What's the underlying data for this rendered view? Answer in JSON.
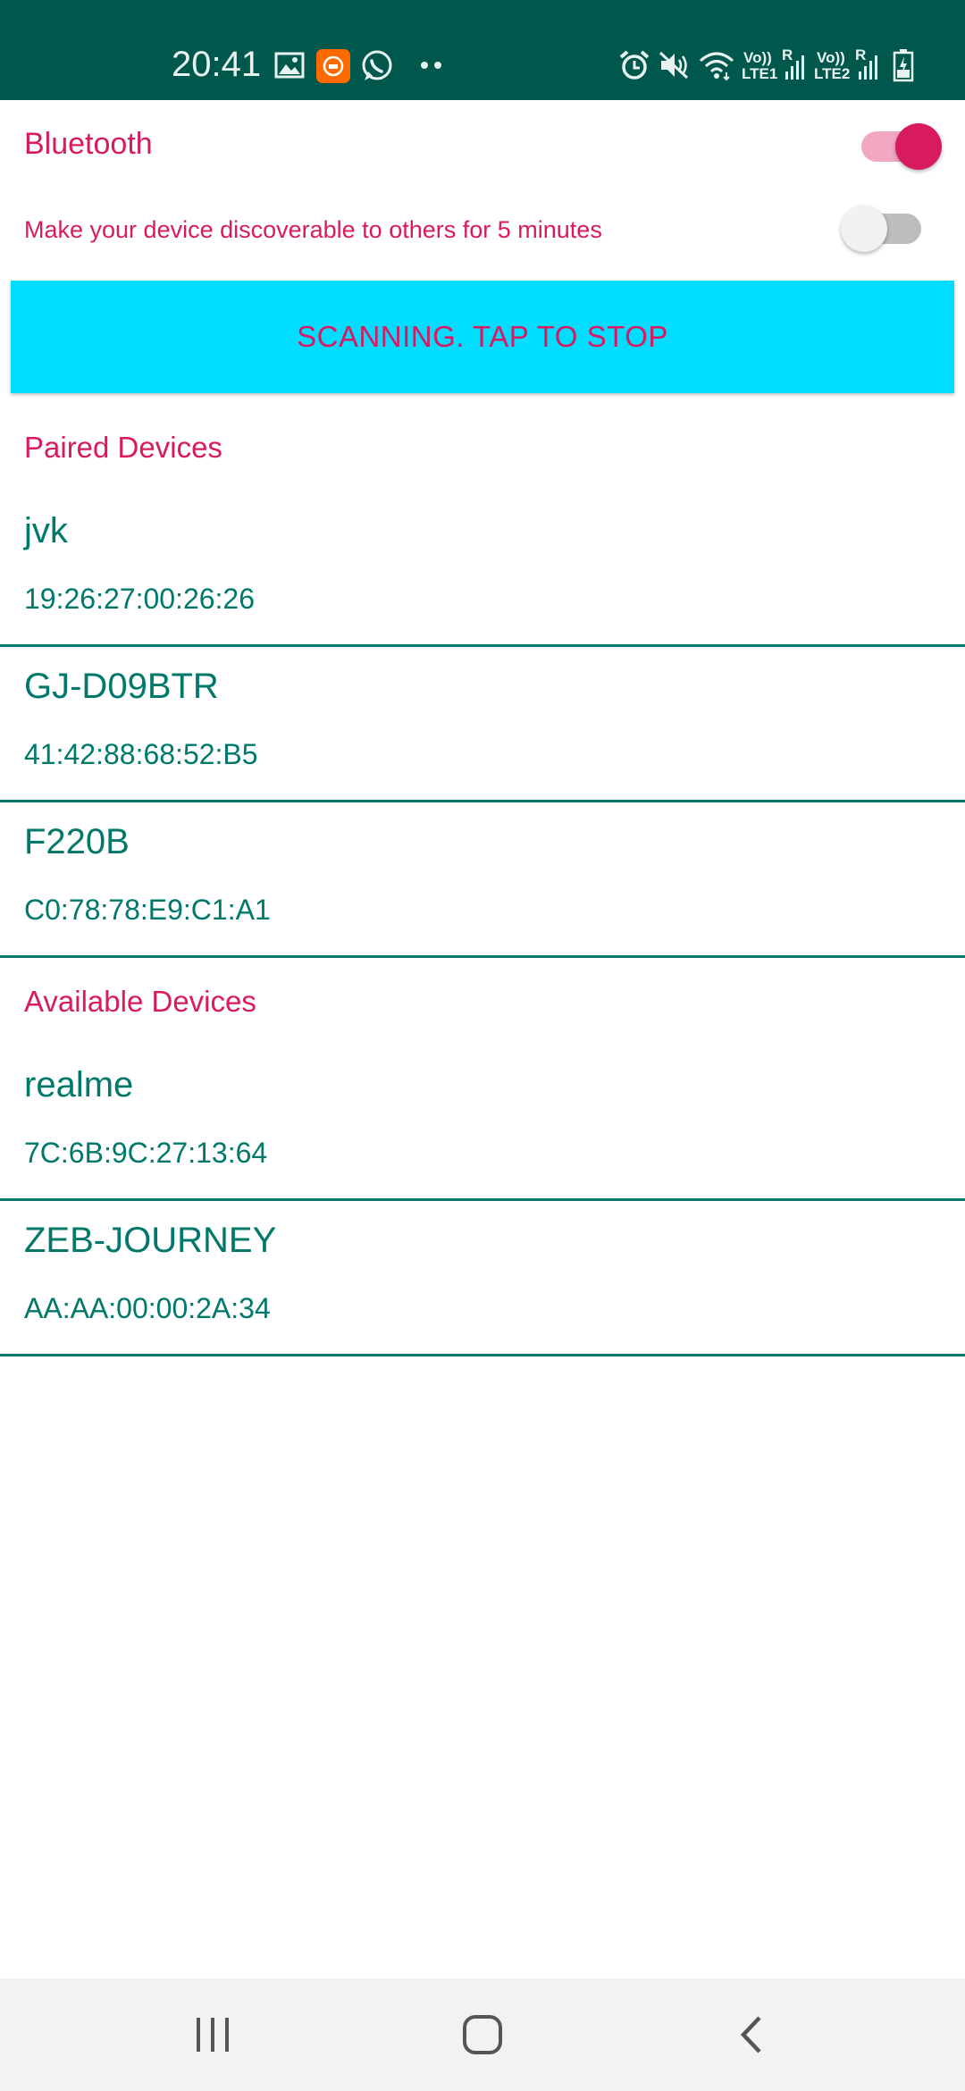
{
  "status_bar": {
    "time": "20:41",
    "sim1_label": "LTE1",
    "sim2_label": "LTE2",
    "volte1": "Vo))",
    "volte2": "Vo))",
    "roaming1": "R",
    "roaming2": "R",
    "icons": [
      "gallery-icon",
      "mi-app-icon",
      "whatsapp-icon",
      "more-dots-icon",
      "alarm-icon",
      "mute-icon",
      "wifi-icon",
      "signal-icon",
      "battery-icon"
    ]
  },
  "bluetooth": {
    "label": "Bluetooth",
    "enabled": true
  },
  "discoverable": {
    "label": "Make your device discoverable to others for 5 minutes",
    "enabled": false
  },
  "scan_button": {
    "label": "SCANNING. TAP TO STOP"
  },
  "paired": {
    "heading": "Paired Devices",
    "devices": [
      {
        "name": "jvk",
        "address": "19:26:27:00:26:26"
      },
      {
        "name": "GJ-D09BTR",
        "address": "41:42:88:68:52:B5"
      },
      {
        "name": "F220B",
        "address": "C0:78:78:E9:C1:A1"
      }
    ]
  },
  "available": {
    "heading": "Available Devices",
    "devices": [
      {
        "name": "realme",
        "address": "7C:6B:9C:27:13:64"
      },
      {
        "name": "ZEB-JOURNEY",
        "address": "AA:AA:00:00:2A:34"
      }
    ]
  },
  "navigation": {
    "icons": [
      "recent-apps-icon",
      "home-icon",
      "back-icon"
    ]
  },
  "colors": {
    "status_bar": "#00574b",
    "accent": "#d81b60",
    "primary_text": "#00796b",
    "scan_button": "#00ddff"
  }
}
